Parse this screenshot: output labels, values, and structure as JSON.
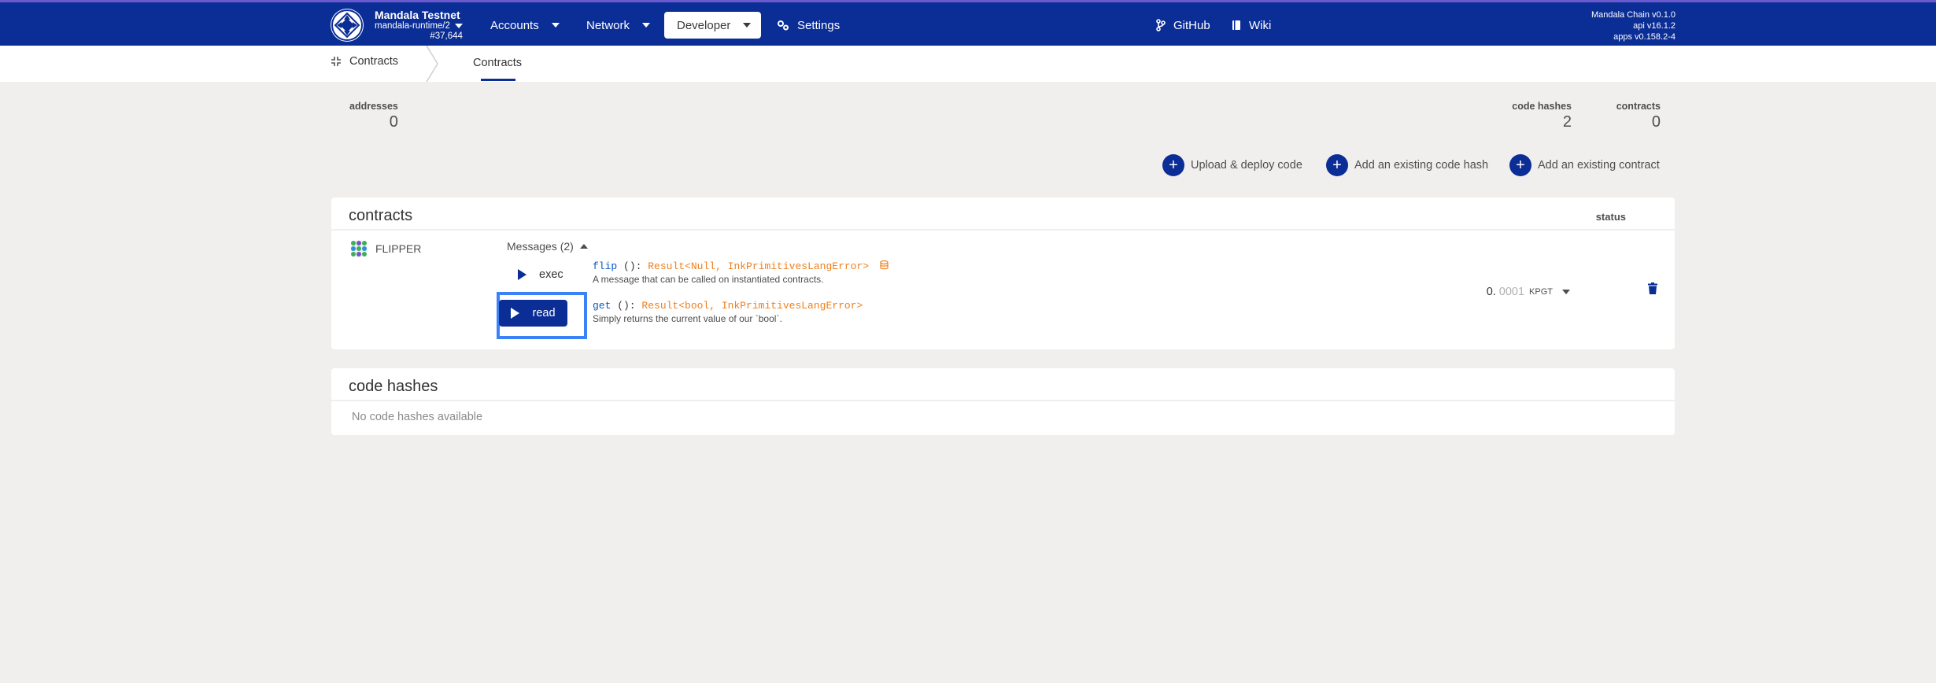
{
  "header": {
    "chain_name": "Mandala Testnet",
    "runtime": "mandala-runtime/2",
    "block": "#37,644",
    "nav": [
      {
        "label": "Accounts"
      },
      {
        "label": "Network"
      },
      {
        "label": "Developer"
      },
      {
        "label": "Settings"
      },
      {
        "label": "GitHub"
      },
      {
        "label": "Wiki"
      }
    ],
    "version_chain": "Mandala Chain v0.1.0",
    "version_api": "api v16.1.2",
    "version_apps": "apps v0.158.2-4"
  },
  "subnav": {
    "home_label": "Contracts",
    "tab_label": "Contracts"
  },
  "summary": {
    "addresses_label": "addresses",
    "addresses_value": "0",
    "code_hashes_label": "code hashes",
    "code_hashes_value": "2",
    "contracts_label": "contracts",
    "contracts_value": "0"
  },
  "actions": {
    "upload": "Upload & deploy code",
    "add_code_hash": "Add an existing code hash",
    "add_contract": "Add an existing contract"
  },
  "contracts_card": {
    "title": "contracts",
    "status_header": "status",
    "contract_name": "FLIPPER",
    "messages_toggle": "Messages (2)",
    "messages": [
      {
        "button": "exec",
        "fn": "flip",
        "parens": " (): ",
        "return_type": "Result<Null, InkPrimitivesLangError>",
        "doc": "A message that can be called on instantiated contracts."
      },
      {
        "button": "read",
        "fn": "get",
        "parens": " (): ",
        "return_type": "Result<bool, InkPrimitivesLangError>",
        "doc": "Simply returns the current value of our `bool`."
      }
    ],
    "balance_int": "0.",
    "balance_dec": "0001",
    "balance_unit": "KPGT"
  },
  "code_hashes_card": {
    "title": "code hashes",
    "empty": "No code hashes available"
  },
  "colors": {
    "brand": "#0b2d96",
    "highlight": "#3b82f6",
    "type": "#f07f1d",
    "function": "#0b57c2"
  }
}
